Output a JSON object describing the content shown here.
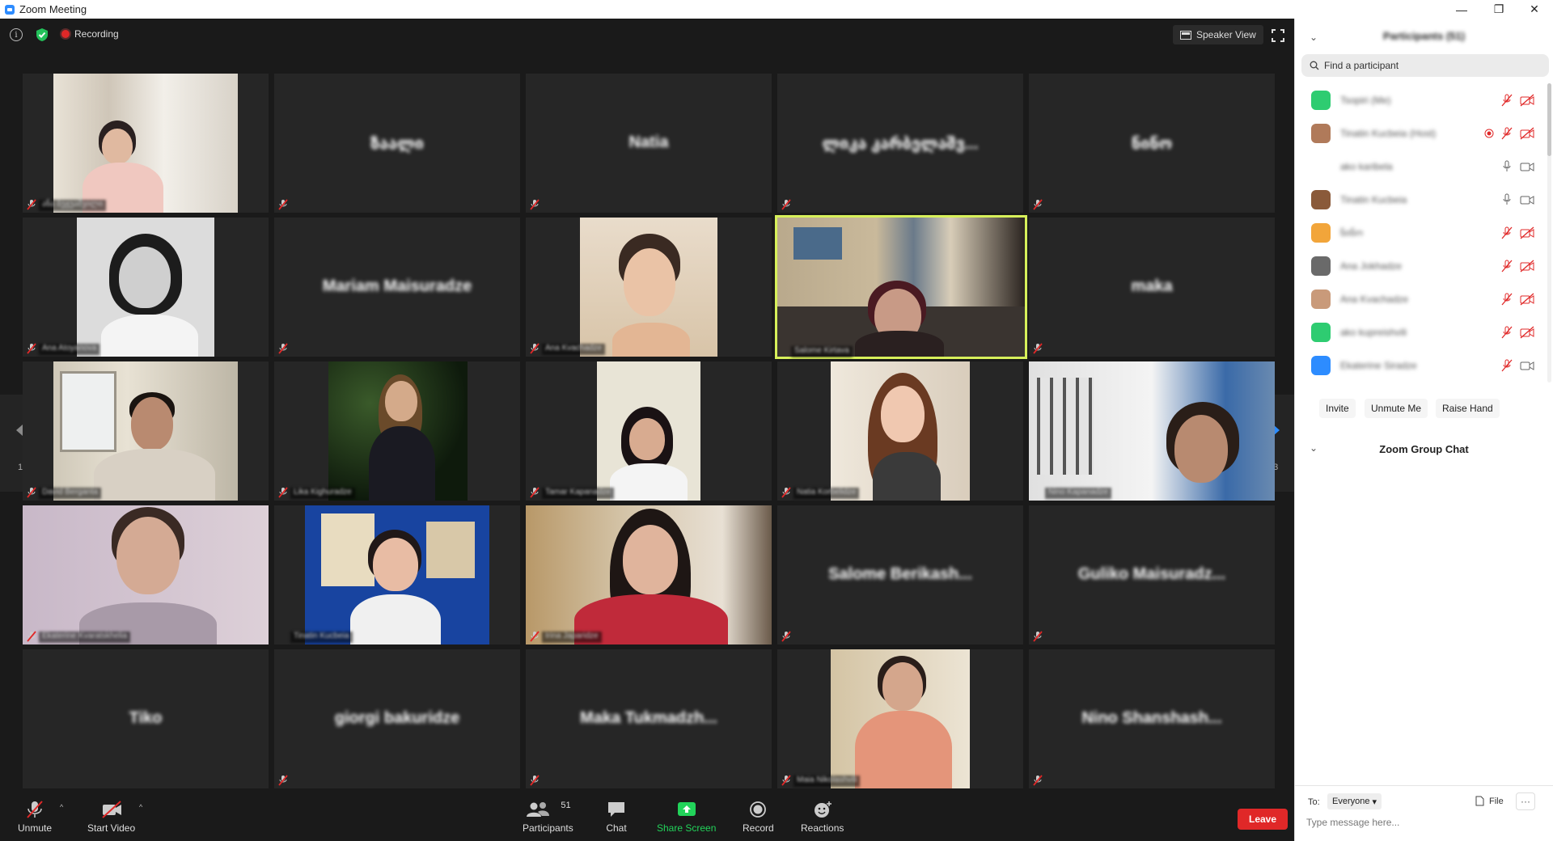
{
  "window": {
    "title": "Zoom Meeting",
    "controls": {
      "minimize": "—",
      "restore": "❐",
      "close": "✕"
    }
  },
  "topbar": {
    "recording_label": "Recording",
    "speaker_view_label": "Speaker View"
  },
  "grid": {
    "page_left": "1/3",
    "page_right": "1/3",
    "tiles": [
      {
        "name": "",
        "tag": "ანა ბეჟუაშვილი",
        "video": true
      },
      {
        "name": "ზაალი",
        "tag": "",
        "video": false
      },
      {
        "name": "Natia",
        "tag": "",
        "video": false
      },
      {
        "name": "ლიკა კარბელაშვ...",
        "tag": "",
        "video": false
      },
      {
        "name": "ნინო",
        "tag": "",
        "video": false
      },
      {
        "name": "",
        "tag": "Ana Atoyanova",
        "video": true
      },
      {
        "name": "Mariam Maisuradze",
        "tag": "",
        "video": false
      },
      {
        "name": "",
        "tag": "Ana Kvachadze",
        "video": true
      },
      {
        "name": "",
        "tag": "Salome Kirtava",
        "video": true
      },
      {
        "name": "maka",
        "tag": "",
        "video": false
      },
      {
        "name": "",
        "tag": "David Berganta",
        "video": true
      },
      {
        "name": "",
        "tag": "Lika Kighuradze",
        "video": true
      },
      {
        "name": "",
        "tag": "Tamar Kapanadze",
        "video": true
      },
      {
        "name": "",
        "tag": "Natia Korbelidze",
        "video": true
      },
      {
        "name": "",
        "tag": "Nino Kapanadze",
        "video": true
      },
      {
        "name": "",
        "tag": "Ekaterine Kvaratskhelia",
        "video": true
      },
      {
        "name": "",
        "tag": "Tinatin Kucbeia",
        "video": true
      },
      {
        "name": "",
        "tag": "Irina Japaridze",
        "video": true
      },
      {
        "name": "Salome Berikash...",
        "tag": "",
        "video": false
      },
      {
        "name": "Guliko Maisuradz...",
        "tag": "",
        "video": false
      },
      {
        "name": "Tiko",
        "tag": "",
        "video": false
      },
      {
        "name": "giorgi bakuridze",
        "tag": "",
        "video": false
      },
      {
        "name": "Maka Tukmadzh...",
        "tag": "",
        "video": false
      },
      {
        "name": "",
        "tag": "Maia Nikolashvili",
        "video": true
      },
      {
        "name": "Nino Shanshash...",
        "tag": "",
        "video": false
      }
    ]
  },
  "toolbar": {
    "unmute_label": "Unmute",
    "start_video_label": "Start Video",
    "participants_label": "Participants",
    "participants_count": "51",
    "chat_label": "Chat",
    "share_label": "Share Screen",
    "record_label": "Record",
    "reactions_label": "Reactions",
    "leave_label": "Leave",
    "colors": {
      "share": "#22d35a",
      "leave": "#e02828"
    }
  },
  "panel": {
    "participants_title": "Participants (51)",
    "search_placeholder": "Find a participant",
    "participants": [
      {
        "name": "Tsopiri (Me)",
        "avatar": "#2ecc71",
        "mic": "muted",
        "cam": "off"
      },
      {
        "name": "Tinatin Kucbeia (Host)",
        "avatar": "#b07a5a",
        "mic": "muted",
        "cam": "off",
        "recording": true
      },
      {
        "name": "ako karibela",
        "avatar": "",
        "mic": "on",
        "cam": "on"
      },
      {
        "name": "Tinatin Kucbeia",
        "avatar": "#8a5a3a",
        "mic": "on",
        "cam": "on"
      },
      {
        "name": "ნინო",
        "avatar": "#f2a53a",
        "mic": "muted",
        "cam": "off"
      },
      {
        "name": "Ana Jokhadze",
        "avatar": "#6a6a6a",
        "mic": "muted",
        "cam": "off"
      },
      {
        "name": "Ana Kvachadze",
        "avatar": "#c99a7a",
        "mic": "muted",
        "cam": "off"
      },
      {
        "name": "ako kupreishvili",
        "avatar": "#2ecc71",
        "mic": "muted",
        "cam": "off"
      },
      {
        "name": "Ekaterine Siradze",
        "avatar": "#2d8cff",
        "mic": "muted",
        "cam": "on"
      }
    ],
    "invite_label": "Invite",
    "unmute_me_label": "Unmute Me",
    "raise_hand_label": "Raise Hand",
    "chat_title": "Zoom Group Chat",
    "to_label": "To:",
    "recipient": "Everyone",
    "file_label": "File",
    "more_label": "···",
    "message_placeholder": "Type message here..."
  }
}
